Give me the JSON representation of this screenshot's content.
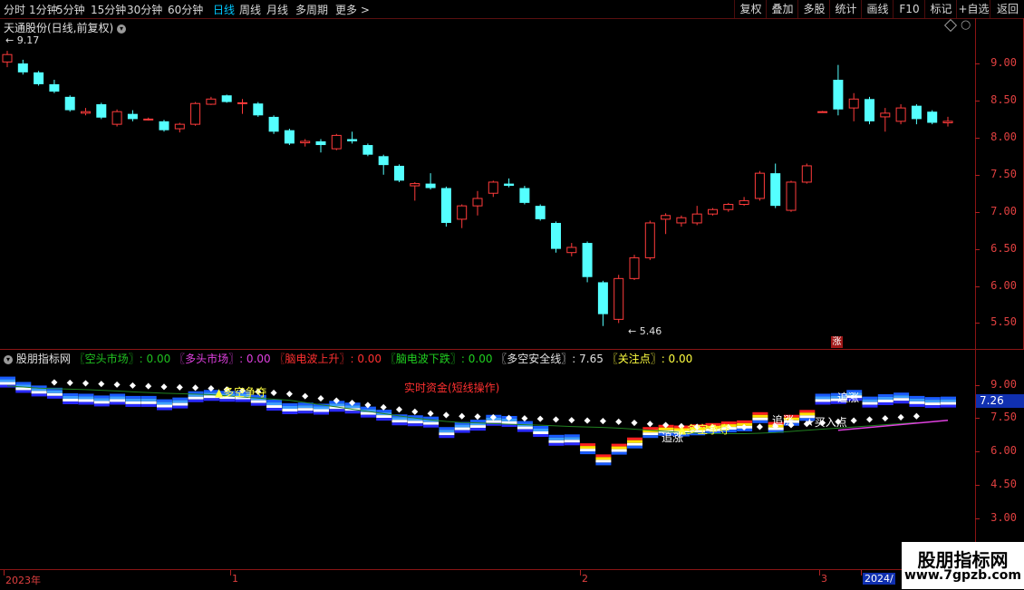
{
  "toolbar": {
    "left_items": [
      {
        "label": "分时"
      },
      {
        "label": "1分钟"
      },
      {
        "label": "5分钟"
      },
      {
        "label": "15分钟"
      },
      {
        "label": "30分钟"
      },
      {
        "label": "60分钟"
      },
      {
        "label": "日线",
        "active": true
      },
      {
        "label": "周线"
      },
      {
        "label": "月线"
      },
      {
        "label": "多周期"
      },
      {
        "label": "更多 >"
      }
    ],
    "right_items": [
      {
        "label": "复权"
      },
      {
        "label": "叠加"
      },
      {
        "label": "多股"
      },
      {
        "label": "统计"
      },
      {
        "label": "画线"
      },
      {
        "label": "F10"
      },
      {
        "label": "标记"
      },
      {
        "label": "+自选"
      },
      {
        "label": "返回"
      }
    ]
  },
  "price_panel": {
    "title": "天通股份(日线,前复权)",
    "high_marker": "9.17",
    "low_marker": "5.46",
    "y_ticks": [
      "9.00",
      "8.50",
      "8.00",
      "7.50",
      "7.00",
      "6.50",
      "6.00",
      "5.50"
    ],
    "y_min": 5.2,
    "y_max": 9.55,
    "badge": "涨"
  },
  "indicator_panel": {
    "title": "股朋指标网",
    "legend": [
      {
        "text": "〖空头市场〗: 0.00",
        "color": "#20c020"
      },
      {
        "text": "〖多头市场〗: 0.00",
        "color": "#e040e0"
      },
      {
        "text": "〖脑电波上升〗: 0.00",
        "color": "#ff3030"
      },
      {
        "text": "〖脑电波下跌〗: 0.00",
        "color": "#20d020"
      },
      {
        "text": "〖多空安全线〗: 7.65",
        "color": "#e0e0e0"
      },
      {
        "text": "〖关注点〗: 0.00",
        "color": "#ffff40"
      }
    ],
    "y_ticks": [
      "9.00",
      "7.50",
      "6.00",
      "4.50",
      "3.00",
      "1.50"
    ],
    "y_min": 0.7,
    "y_max": 10.0,
    "current_value": "7.26",
    "annotations": [
      {
        "text": "▲多空争夺",
        "color": "#ffff40"
      },
      {
        "text": "实时资金(短线操作)",
        "color": "#ff3030"
      },
      {
        "text": "▲多空争夺",
        "color": "#ffff40"
      },
      {
        "text": "追涨",
        "color": "#ffffff"
      },
      {
        "text": "追涨",
        "color": "#ffffff"
      },
      {
        "text": "追涨",
        "color": "#ffffff"
      },
      {
        "text": "★买入点",
        "color": "#ffffff"
      }
    ]
  },
  "date_axis": {
    "labels": [
      "2023年",
      "1",
      "2",
      "3",
      "2024/"
    ]
  },
  "watermark": {
    "title": "股朋指标网",
    "url": "www.7gpzb.com"
  },
  "chart_data": {
    "type": "candlestick",
    "candles": [
      {
        "o": 9.02,
        "h": 9.17,
        "l": 8.95,
        "c": 9.12
      },
      {
        "o": 9.0,
        "h": 9.05,
        "l": 8.85,
        "c": 8.88
      },
      {
        "o": 8.88,
        "h": 8.9,
        "l": 8.7,
        "c": 8.72
      },
      {
        "o": 8.72,
        "h": 8.78,
        "l": 8.6,
        "c": 8.62
      },
      {
        "o": 8.55,
        "h": 8.57,
        "l": 8.35,
        "c": 8.37
      },
      {
        "o": 8.33,
        "h": 8.4,
        "l": 8.3,
        "c": 8.35
      },
      {
        "o": 8.45,
        "h": 8.47,
        "l": 8.25,
        "c": 8.27
      },
      {
        "o": 8.18,
        "h": 8.38,
        "l": 8.15,
        "c": 8.35
      },
      {
        "o": 8.32,
        "h": 8.37,
        "l": 8.22,
        "c": 8.25
      },
      {
        "o": 8.25,
        "h": 8.27,
        "l": 8.23,
        "c": 8.25
      },
      {
        "o": 8.22,
        "h": 8.24,
        "l": 8.08,
        "c": 8.1
      },
      {
        "o": 8.12,
        "h": 8.2,
        "l": 8.07,
        "c": 8.18
      },
      {
        "o": 8.18,
        "h": 8.48,
        "l": 8.16,
        "c": 8.46
      },
      {
        "o": 8.45,
        "h": 8.55,
        "l": 8.44,
        "c": 8.52
      },
      {
        "o": 8.57,
        "h": 8.58,
        "l": 8.47,
        "c": 8.48
      },
      {
        "o": 8.47,
        "h": 8.52,
        "l": 8.32,
        "c": 8.47
      },
      {
        "o": 8.46,
        "h": 8.48,
        "l": 8.28,
        "c": 8.3
      },
      {
        "o": 8.28,
        "h": 8.3,
        "l": 8.05,
        "c": 8.08
      },
      {
        "o": 8.1,
        "h": 8.12,
        "l": 7.9,
        "c": 7.92
      },
      {
        "o": 7.93,
        "h": 7.98,
        "l": 7.88,
        "c": 7.95
      },
      {
        "o": 7.95,
        "h": 7.98,
        "l": 7.8,
        "c": 7.9
      },
      {
        "o": 7.85,
        "h": 8.05,
        "l": 7.83,
        "c": 8.03
      },
      {
        "o": 7.98,
        "h": 8.08,
        "l": 7.92,
        "c": 7.95
      },
      {
        "o": 7.9,
        "h": 7.92,
        "l": 7.75,
        "c": 7.77
      },
      {
        "o": 7.75,
        "h": 7.77,
        "l": 7.5,
        "c": 7.63
      },
      {
        "o": 7.62,
        "h": 7.64,
        "l": 7.4,
        "c": 7.42
      },
      {
        "o": 7.35,
        "h": 7.4,
        "l": 7.15,
        "c": 7.38
      },
      {
        "o": 7.38,
        "h": 7.52,
        "l": 7.3,
        "c": 7.32
      },
      {
        "o": 7.32,
        "h": 7.34,
        "l": 6.8,
        "c": 6.85
      },
      {
        "o": 6.9,
        "h": 7.1,
        "l": 6.78,
        "c": 7.08
      },
      {
        "o": 7.08,
        "h": 7.28,
        "l": 6.95,
        "c": 7.18
      },
      {
        "o": 7.25,
        "h": 7.42,
        "l": 7.2,
        "c": 7.4
      },
      {
        "o": 7.38,
        "h": 7.45,
        "l": 7.33,
        "c": 7.35
      },
      {
        "o": 7.32,
        "h": 7.35,
        "l": 7.1,
        "c": 7.12
      },
      {
        "o": 7.08,
        "h": 7.1,
        "l": 6.88,
        "c": 6.9
      },
      {
        "o": 6.85,
        "h": 6.87,
        "l": 6.45,
        "c": 6.5
      },
      {
        "o": 6.45,
        "h": 6.58,
        "l": 6.4,
        "c": 6.52
      },
      {
        "o": 6.58,
        "h": 6.6,
        "l": 6.05,
        "c": 6.12
      },
      {
        "o": 6.05,
        "h": 6.07,
        "l": 5.46,
        "c": 5.62
      },
      {
        "o": 5.55,
        "h": 6.15,
        "l": 5.5,
        "c": 6.1
      },
      {
        "o": 6.1,
        "h": 6.42,
        "l": 6.08,
        "c": 6.38
      },
      {
        "o": 6.38,
        "h": 6.88,
        "l": 6.35,
        "c": 6.85
      },
      {
        "o": 6.9,
        "h": 6.98,
        "l": 6.7,
        "c": 6.95
      },
      {
        "o": 6.85,
        "h": 6.95,
        "l": 6.8,
        "c": 6.92
      },
      {
        "o": 6.85,
        "h": 7.08,
        "l": 6.82,
        "c": 6.97
      },
      {
        "o": 6.97,
        "h": 7.05,
        "l": 6.95,
        "c": 7.03
      },
      {
        "o": 7.03,
        "h": 7.12,
        "l": 7.0,
        "c": 7.1
      },
      {
        "o": 7.1,
        "h": 7.2,
        "l": 7.08,
        "c": 7.15
      },
      {
        "o": 7.18,
        "h": 7.55,
        "l": 7.15,
        "c": 7.52
      },
      {
        "o": 7.52,
        "h": 7.65,
        "l": 7.05,
        "c": 7.08
      },
      {
        "o": 7.02,
        "h": 7.42,
        "l": 7.0,
        "c": 7.4
      },
      {
        "o": 7.4,
        "h": 7.65,
        "l": 7.38,
        "c": 7.62
      },
      {
        "o": 8.35,
        "h": 8.36,
        "l": 8.34,
        "c": 8.35
      },
      {
        "o": 8.78,
        "h": 8.98,
        "l": 8.3,
        "c": 8.38
      },
      {
        "o": 8.4,
        "h": 8.6,
        "l": 8.22,
        "c": 8.52
      },
      {
        "o": 8.52,
        "h": 8.55,
        "l": 8.18,
        "c": 8.22
      },
      {
        "o": 8.28,
        "h": 8.4,
        "l": 8.08,
        "c": 8.33
      },
      {
        "o": 8.22,
        "h": 8.45,
        "l": 8.18,
        "c": 8.4
      },
      {
        "o": 8.43,
        "h": 8.45,
        "l": 8.18,
        "c": 8.25
      },
      {
        "o": 8.35,
        "h": 8.37,
        "l": 8.18,
        "c": 8.2
      },
      {
        "o": 8.2,
        "h": 8.28,
        "l": 8.15,
        "c": 8.22
      }
    ],
    "safety_line": [
      8.95,
      8.9,
      8.85,
      8.82,
      8.8,
      8.78,
      8.75,
      8.72,
      8.68,
      8.65,
      8.62,
      8.6,
      8.58,
      8.55,
      8.5,
      8.45,
      8.4,
      8.35,
      8.3,
      8.2,
      8.1,
      8.0,
      7.9,
      7.8,
      7.7,
      7.6,
      7.5,
      7.42,
      7.35,
      7.3,
      7.28,
      7.25,
      7.22,
      7.2,
      7.18,
      7.15,
      7.12,
      7.1,
      7.08,
      7.05,
      7.0,
      6.95,
      6.9,
      6.85,
      6.82,
      6.8,
      6.8,
      6.8,
      6.82,
      6.85,
      6.9,
      6.95,
      7.0,
      7.05,
      7.1,
      7.15,
      7.2,
      7.25,
      7.3
    ]
  }
}
